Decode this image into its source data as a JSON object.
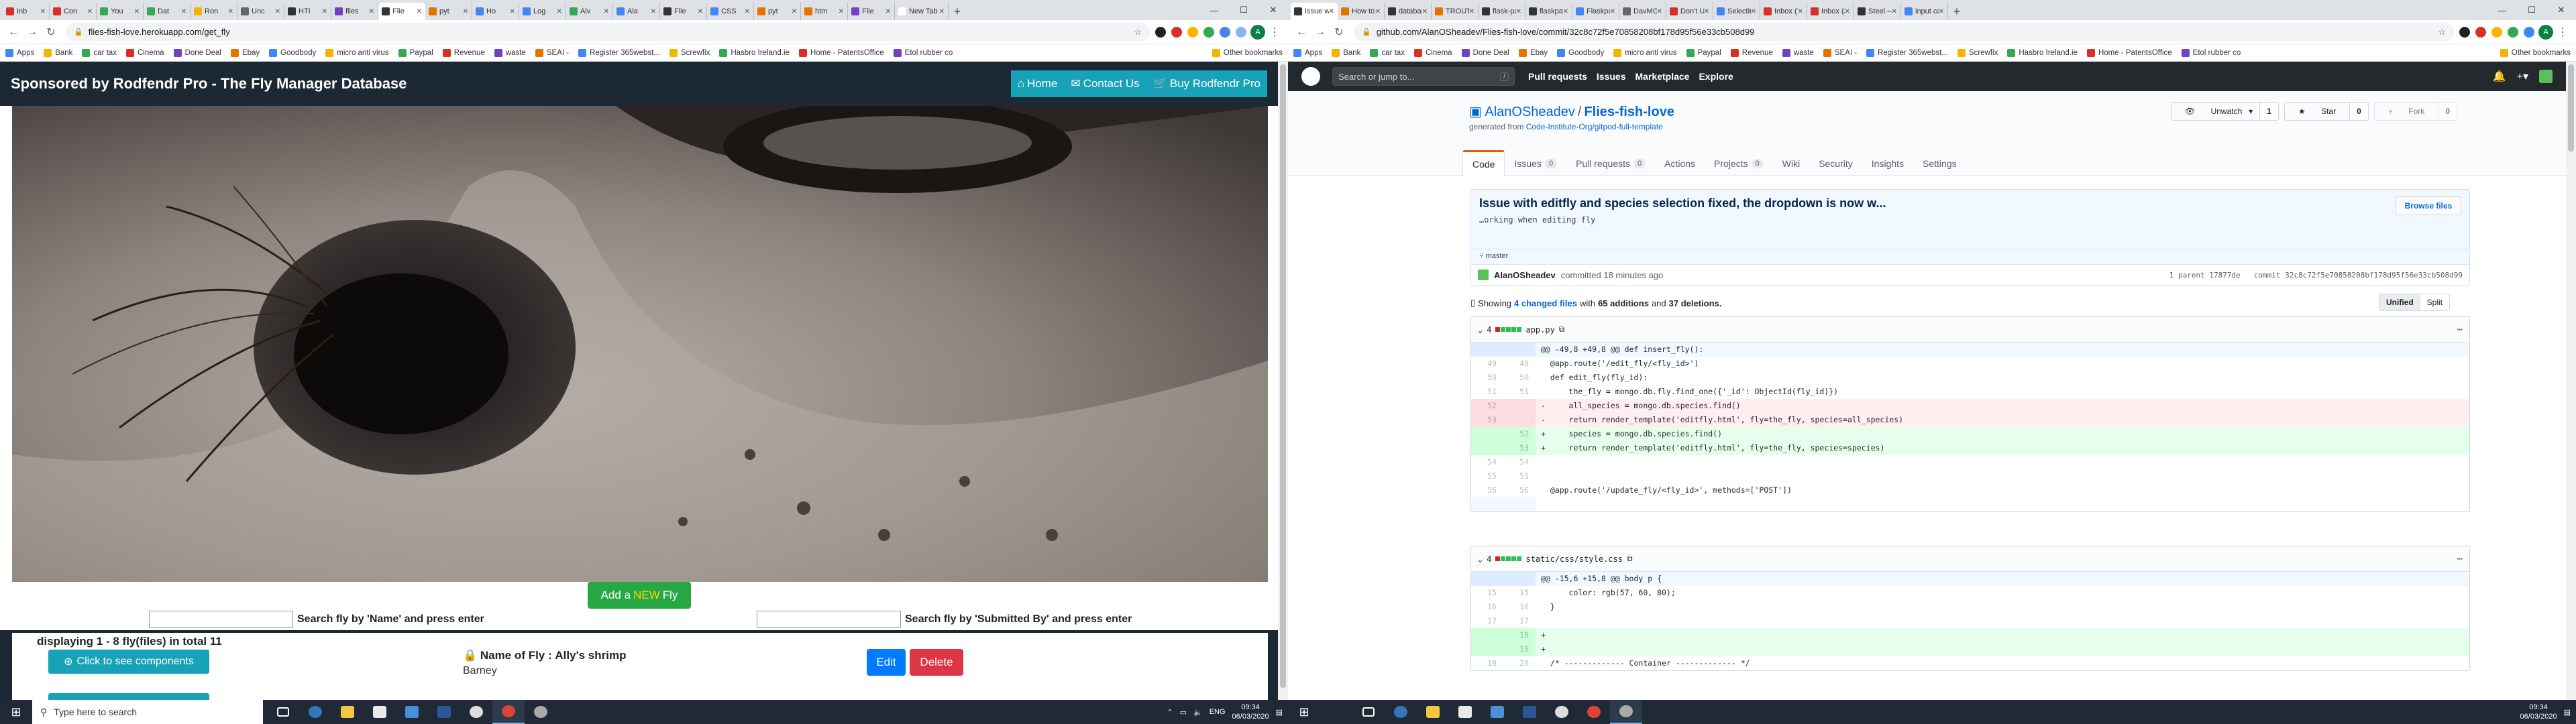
{
  "left": {
    "tabs": [
      {
        "label": "Inb",
        "color": "#d93025"
      },
      {
        "label": "Con",
        "color": "#d93025"
      },
      {
        "label": "You",
        "color": "#34a853"
      },
      {
        "label": "Dat",
        "color": "#34a853"
      },
      {
        "label": "Ron",
        "color": "#f4b400"
      },
      {
        "label": "Unc",
        "color": "#666666"
      },
      {
        "label": "HTI",
        "color": "#333333"
      },
      {
        "label": "flies",
        "color": "#6f42c1"
      },
      {
        "label": "Flie",
        "color": "#333333",
        "active": true
      },
      {
        "label": "pyt",
        "color": "#e37400"
      },
      {
        "label": "Ho",
        "color": "#4285f4"
      },
      {
        "label": "Log",
        "color": "#4285f4"
      },
      {
        "label": "Alv",
        "color": "#34a853"
      },
      {
        "label": "Ala",
        "color": "#4285f4"
      },
      {
        "label": "Flie",
        "color": "#333333"
      },
      {
        "label": "CSS",
        "color": "#4285f4"
      },
      {
        "label": "pyt",
        "color": "#e37400"
      },
      {
        "label": "htm",
        "color": "#e37400"
      },
      {
        "label": "Flie",
        "color": "#6f42c1"
      },
      {
        "label": "New Tab",
        "color": "#ffffff"
      }
    ],
    "url": "flies-fish-love.herokuapp.com/get_fly",
    "bookmarks": [
      "Apps",
      "Bank",
      "car tax",
      "Cinema",
      "Done Deal",
      "Ebay",
      "Goodbody",
      "micro anti virus",
      "Paypal",
      "Revenue",
      "waste",
      "SEAI -",
      "Register 365webst...",
      "Screwfix",
      "Hasbro Ireland.ie",
      "Home - PatentsOffice",
      "Etol rubber co"
    ],
    "bookmarks_right": "Other bookmarks",
    "site": {
      "title": "Sponsored by Rodfendr Pro - The Fly Manager Database",
      "nav": [
        "Home",
        "Contact Us",
        "Buy Rodfendr Pro"
      ]
    },
    "add_button": {
      "prefix": "Add a",
      "highlight": "NEW",
      "suffix": "Fly"
    },
    "search_name": {
      "placeholder": "",
      "label": "Search fly by 'Name' and press enter"
    },
    "search_submitted": {
      "placeholder": "",
      "label": "Search fly by 'Submitted By' and press enter"
    },
    "displaying": "displaying 1 - 8 fly(files) in total 11",
    "components_button": "Click to see components",
    "fly": {
      "name_label": "Name of Fly :",
      "name": "Ally's shrimp",
      "submitted": "Barney"
    },
    "edit_button": "Edit",
    "delete_button": "Delete"
  },
  "right": {
    "tabs": [
      {
        "label": "Issue with e",
        "color": "#333333",
        "active": true
      },
      {
        "label": "How to tie",
        "color": "#e37400"
      },
      {
        "label": "database-r",
        "color": "#333333"
      },
      {
        "label": "TROUTMA",
        "color": "#e37400"
      },
      {
        "label": "flask-pagin",
        "color": "#333333"
      },
      {
        "label": "flaskpagina",
        "color": "#333333"
      },
      {
        "label": "Flaskpagina",
        "color": "#4285f4"
      },
      {
        "label": "DavMGame",
        "color": "#666666"
      },
      {
        "label": "Don't Use",
        "color": "#d93025"
      },
      {
        "label": "Selecting fr",
        "color": "#4285f4"
      },
      {
        "label": "Inbox (7)",
        "color": "#d93025"
      },
      {
        "label": "Inbox (3)",
        "color": "#d93025"
      },
      {
        "label": "Steel — Mi",
        "color": "#333333"
      },
      {
        "label": "input case",
        "color": "#4285f4"
      }
    ],
    "url": "github.com/AlanOSheadev/Flies-fish-love/commit/32c8c72f5e70858208bf178d95f56e33cb508d99",
    "github": {
      "search_placeholder": "Search or jump to...",
      "nav": [
        "Pull requests",
        "Issues",
        "Marketplace",
        "Explore"
      ],
      "owner": "AlanOSheadev",
      "repo": "Flies-fish-love",
      "generated_prefix": "generated from",
      "generated_link": "Code-Institute-Org/gitpod-full-template",
      "unwatch": "Unwatch",
      "unwatch_count": "1",
      "star": "Star",
      "star_count": "0",
      "fork": "Fork",
      "fork_count": "0",
      "tabs": [
        {
          "label": "Code",
          "count": ""
        },
        {
          "label": "Issues",
          "count": "0"
        },
        {
          "label": "Pull requests",
          "count": "0"
        },
        {
          "label": "Actions",
          "count": ""
        },
        {
          "label": "Projects",
          "count": "0"
        },
        {
          "label": "Wiki",
          "count": ""
        },
        {
          "label": "Security",
          "count": ""
        },
        {
          "label": "Insights",
          "count": ""
        },
        {
          "label": "Settings",
          "count": ""
        }
      ],
      "commit_title": "Issue with editfly and species selection fixed, the dropdown is now w...",
      "commit_desc": "…orking when editing fly",
      "browse_files": "Browse files",
      "branch": "master",
      "author": "AlanOSheadev",
      "committed": "committed 18 minutes ago",
      "parent": "1 parent 17877de",
      "commit_hash": "commit 32c8c72f5e70858208bf178d95f56e33cb508d99",
      "summary_prefix": "Showing",
      "changed_files": "4 changed files",
      "summary_mid": "with",
      "additions": "65 additions",
      "summary_and": "and",
      "deletions": "37 deletions.",
      "unified": "Unified",
      "split": "Split",
      "file1": {
        "count": "4",
        "name": "app.py"
      },
      "file2": {
        "count": "4",
        "name": "static/css/style.css"
      },
      "diff1": [
        {
          "type": "hunk",
          "o": "",
          "n": "",
          "code": "@@ -49,8 +49,8 @@ def insert_fly():"
        },
        {
          "type": "ctx",
          "o": "49",
          "n": "49",
          "code": "  @app.route('/edit_fly/<fly_id>')"
        },
        {
          "type": "ctx",
          "o": "50",
          "n": "50",
          "code": "  def edit_fly(fly_id):"
        },
        {
          "type": "ctx",
          "o": "51",
          "n": "51",
          "code": "      the_fly = mongo.db.fly.find_one({'_id': ObjectId(fly_id)})"
        },
        {
          "type": "del",
          "o": "52",
          "n": "",
          "code": "-     all_species = mongo.db.species.find()"
        },
        {
          "type": "del",
          "o": "53",
          "n": "",
          "code": "-     return render_template('editfly.html', fly=the_fly, species=all_species)"
        },
        {
          "type": "add",
          "o": "",
          "n": "52",
          "code": "+     species = mongo.db.species.find()"
        },
        {
          "type": "add",
          "o": "",
          "n": "53",
          "code": "+     return render_template('editfly.html', fly=the_fly, species=species)"
        },
        {
          "type": "ctx",
          "o": "54",
          "n": "54",
          "code": ""
        },
        {
          "type": "ctx",
          "o": "55",
          "n": "55",
          "code": ""
        },
        {
          "type": "ctx",
          "o": "56",
          "n": "56",
          "code": "  @app.route('/update_fly/<fly_id>', methods=['POST'])"
        },
        {
          "type": "blank",
          "o": "",
          "n": "",
          "code": ""
        }
      ],
      "diff2": [
        {
          "type": "hunk",
          "o": "",
          "n": "",
          "code": "@@ -15,6 +15,8 @@ body p {"
        },
        {
          "type": "ctx",
          "o": "15",
          "n": "15",
          "code": "      color: rgb(57, 60, 80);"
        },
        {
          "type": "ctx",
          "o": "16",
          "n": "16",
          "code": "  }"
        },
        {
          "type": "ctx",
          "o": "17",
          "n": "17",
          "code": ""
        },
        {
          "type": "add",
          "o": "",
          "n": "18",
          "code": "+"
        },
        {
          "type": "add",
          "o": "",
          "n": "19",
          "code": "+"
        },
        {
          "type": "ctx",
          "o": "18",
          "n": "20",
          "code": "  /* ------------- Container ------------- */"
        }
      ]
    }
  },
  "taskbar": {
    "search": "Type here to search",
    "time": "09:34",
    "date": "06/03/2020",
    "lang": "ENG"
  }
}
